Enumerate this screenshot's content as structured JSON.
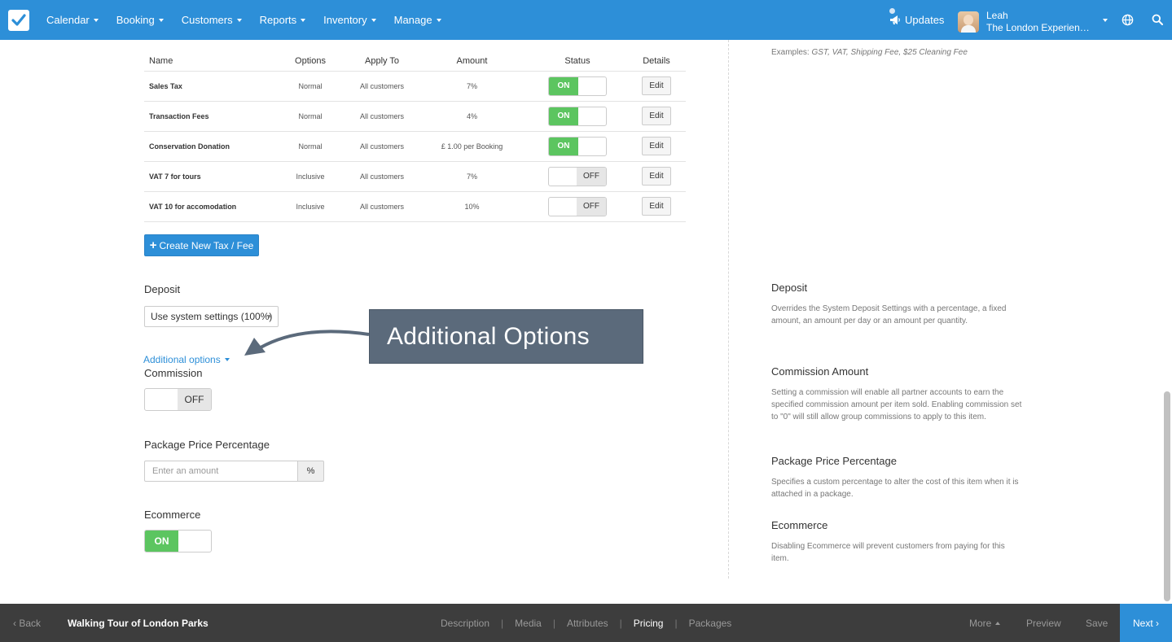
{
  "nav": {
    "items": [
      "Calendar",
      "Booking",
      "Customers",
      "Reports",
      "Inventory",
      "Manage"
    ],
    "updates_label": "Updates",
    "user_name": "Leah",
    "user_org": "The London Experience Company"
  },
  "taxes": {
    "headers": {
      "name": "Name",
      "options": "Options",
      "apply_to": "Apply To",
      "amount": "Amount",
      "status": "Status",
      "details": "Details"
    },
    "rows": [
      {
        "name": "Sales Tax",
        "options": "Normal",
        "apply_to": "All customers",
        "amount": "7%",
        "status": "ON",
        "details": "Edit"
      },
      {
        "name": "Transaction Fees",
        "options": "Normal",
        "apply_to": "All customers",
        "amount": "4%",
        "status": "ON",
        "details": "Edit"
      },
      {
        "name": "Conservation Donation",
        "options": "Normal",
        "apply_to": "All customers",
        "amount": "£ 1.00 per Booking",
        "status": "ON",
        "details": "Edit"
      },
      {
        "name": "VAT 7 for tours",
        "options": "Inclusive",
        "apply_to": "All customers",
        "amount": "7%",
        "status": "OFF",
        "details": "Edit"
      },
      {
        "name": "VAT 10 for accomodation",
        "options": "Inclusive",
        "apply_to": "All customers",
        "amount": "10%",
        "status": "OFF",
        "details": "Edit"
      }
    ],
    "create_label": "Create New Tax / Fee"
  },
  "form": {
    "deposit_label": "Deposit",
    "deposit_value": "Use system settings (100%)",
    "additional_options_link": "Additional options",
    "commission_label": "Commission",
    "commission_status": "OFF",
    "package_label": "Package Price Percentage",
    "package_placeholder": "Enter an amount",
    "package_suffix": "%",
    "ecommerce_label": "Ecommerce",
    "ecommerce_status": "ON"
  },
  "callout": {
    "text": "Additional Options"
  },
  "help": {
    "examples_prefix": "Examples:",
    "examples_text": "GST, VAT, Shipping Fee, $25 Cleaning Fee",
    "deposit_title": "Deposit",
    "deposit_body": "Overrides the System Deposit Settings with a percentage, a fixed amount, an amount per day or an amount per quantity.",
    "commission_title": "Commission Amount",
    "commission_body": "Setting a commission will enable all partner accounts to earn the specified commission amount per item sold. Enabling commission set to \"0\" will still allow group commissions to apply to this item.",
    "package_title": "Package Price Percentage",
    "package_body": "Specifies a custom percentage to alter the cost of this item when it is attached in a package.",
    "ecommerce_title": "Ecommerce",
    "ecommerce_body": "Disabling Ecommerce will prevent customers from paying for this item."
  },
  "bottom": {
    "back_label": "‹ Back",
    "item_title": "Walking Tour of London Parks",
    "tabs": [
      "Description",
      "Media",
      "Attributes",
      "Pricing",
      "Packages"
    ],
    "active_tab": "Pricing",
    "more_label": "More",
    "preview_label": "Preview",
    "save_label": "Save",
    "next_label": "Next ›"
  },
  "colors": {
    "primary": "#2d8fd8",
    "toggle_on": "#5cc560",
    "callout": "#5b6a7b",
    "bottom_bar": "#3d3d3d"
  },
  "icons": [
    "checkbox-logo-icon",
    "megaphone-icon",
    "globe-icon",
    "search-icon",
    "caret-down-icon",
    "plus-icon"
  ]
}
